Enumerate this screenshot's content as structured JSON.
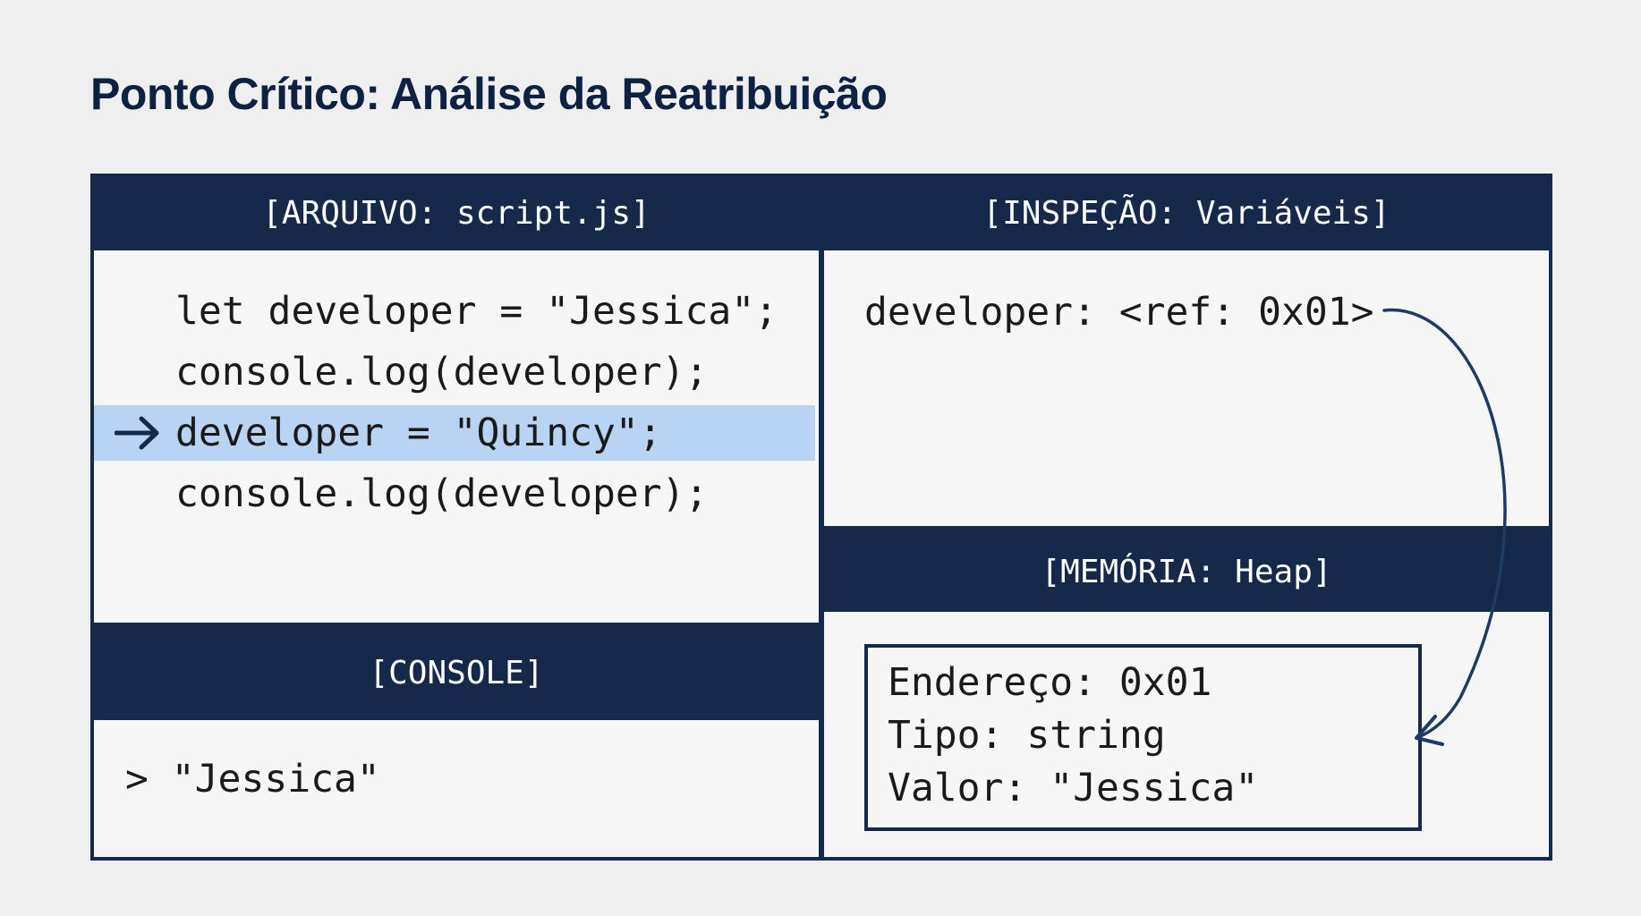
{
  "title": "Ponto Crítico: Análise da Reatribuição",
  "panels": {
    "script": {
      "header": "[ARQUIVO: script.js]",
      "lines": [
        "let developer = \"Jessica\";",
        "console.log(developer);",
        "developer = \"Quincy\";",
        "console.log(developer);"
      ],
      "current_line_index": 2
    },
    "inspection": {
      "header": "[INSPEÇÃO: Variáveis]",
      "variable": "developer: <ref: 0x01>"
    },
    "console": {
      "header": "[CONSOLE]",
      "output": "> \"Jessica\""
    },
    "memory": {
      "header": "[MEMÓRIA: Heap]",
      "address": "Endereço: 0x01",
      "type": "Tipo: string",
      "value": "Valor: \"Jessica\""
    }
  },
  "colors": {
    "header_bg": "#16294a",
    "highlight": "#b9d3f3",
    "arrow": "#1f3a63",
    "page_bg": "#efefef"
  },
  "icons": {
    "current_line": "right-arrow-icon",
    "reference": "curved-arrow-icon"
  }
}
